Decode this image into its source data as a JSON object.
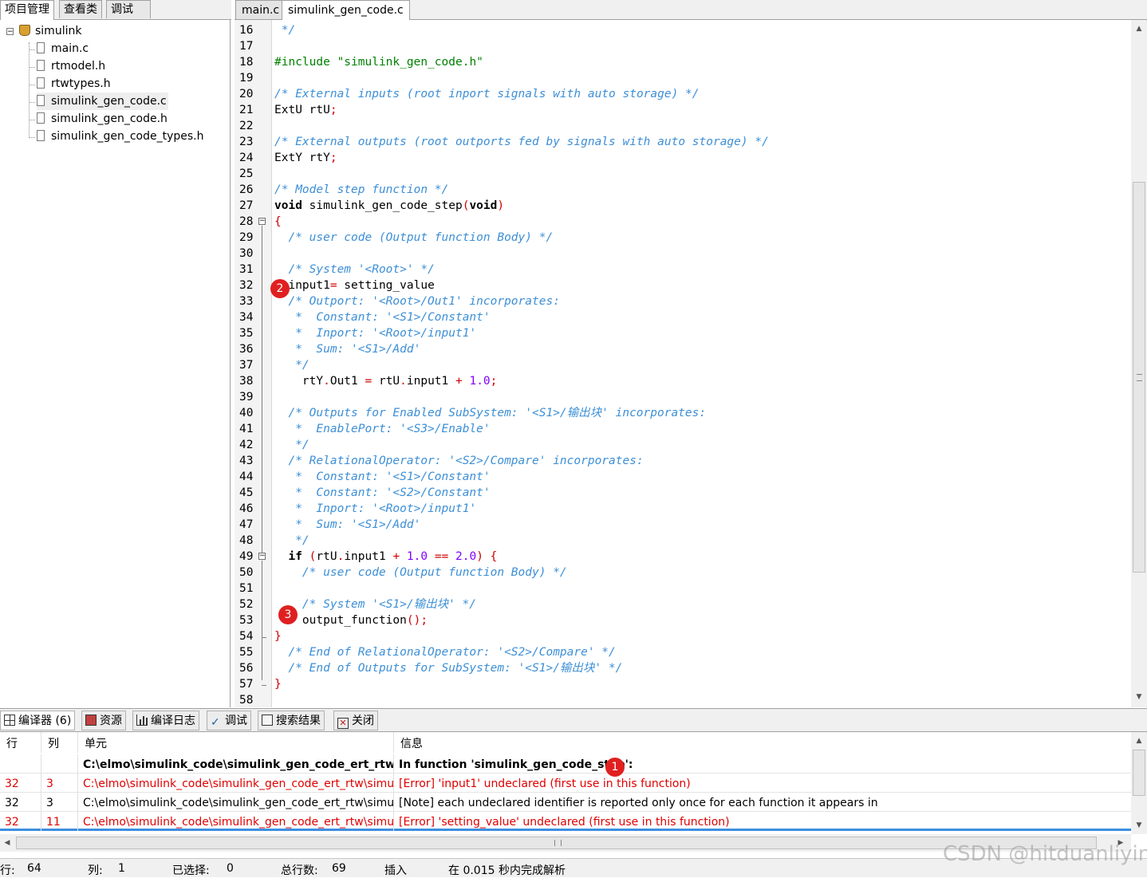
{
  "left_panel": {
    "tabs": [
      "项目管理",
      "查看类",
      "调试"
    ],
    "project": "simulink",
    "files": [
      "main.c",
      "rtmodel.h",
      "rtwtypes.h",
      "simulink_gen_code.c",
      "simulink_gen_code.h",
      "simulink_gen_code_types.h"
    ]
  },
  "editor": {
    "tabs": [
      "main.c",
      "simulink_gen_code.c"
    ],
    "line_numbers": [
      "16",
      "17",
      "18",
      "19",
      "20",
      "21",
      "22",
      "23",
      "24",
      "25",
      "26",
      "27",
      "28",
      "29",
      "30",
      "31",
      "32",
      "33",
      "34",
      "35",
      "36",
      "37",
      "38",
      "39",
      "40",
      "41",
      "42",
      "43",
      "44",
      "45",
      "46",
      "47",
      "48",
      "49",
      "50",
      "51",
      "52",
      "53",
      "54",
      "55",
      "56",
      "57",
      "58"
    ],
    "code": {
      "l16": " */",
      "l18_a": "#include ",
      "l18_b": "\"simulink_gen_code.h\"",
      "l20": "/* External inputs (root inport signals with auto storage) */",
      "l21_a": "ExtU rtU",
      "l21_b": ";",
      "l23": "/* External outputs (root outports fed by signals with auto storage) */",
      "l24_a": "ExtY rtY",
      "l24_b": ";",
      "l26": "/* Model step function */",
      "l27_a": "void",
      "l27_b": " simulink_gen_code_step",
      "l27_c": "(",
      "l27_d": "void",
      "l27_e": ")",
      "l28": "{",
      "l29": "  /* user code (Output function Body) */",
      "l31": "  /* System '<Root>' */",
      "l32_a": "  input1",
      "l32_b": "=",
      "l32_c": " setting_value",
      "l33": "  /* Outport: '<Root>/Out1' incorporates:",
      "l34": "   *  Constant: '<S1>/Constant'",
      "l35": "   *  Inport: '<Root>/input1'",
      "l36": "   *  Sum: '<S1>/Add'",
      "l37": "   */",
      "l38_a": "    rtY",
      "l38_b": ".",
      "l38_c": "Out1 ",
      "l38_d": "=",
      "l38_e": " rtU",
      "l38_f": ".",
      "l38_g": "input1 ",
      "l38_h": "+",
      "l38_i": " 1.0",
      "l38_j": ";",
      "l40": "  /* Outputs for Enabled SubSystem: '<S1>/输出块' incorporates:",
      "l41": "   *  EnablePort: '<S3>/Enable'",
      "l42": "   */",
      "l43": "  /* RelationalOperator: '<S2>/Compare' incorporates:",
      "l44": "   *  Constant: '<S1>/Constant'",
      "l45": "   *  Constant: '<S2>/Constant'",
      "l46": "   *  Inport: '<Root>/input1'",
      "l47": "   *  Sum: '<S1>/Add'",
      "l48": "   */",
      "l49_a": "  if",
      "l49_b": " (",
      "l49_c": "rtU",
      "l49_d": ".",
      "l49_e": "input1 ",
      "l49_f": "+",
      "l49_g": " 1.0 ",
      "l49_h": "==",
      "l49_i": " 2.0",
      "l49_j": ") {",
      "l50": "    /* user code (Output function Body) */",
      "l52": "    /* System '<S1>/输出块' */",
      "l53_a": "    output_function",
      "l53_b": "();",
      "l54": "}",
      "l55": "  /* End of RelationalOperator: '<S2>/Compare' */",
      "l56": "  /* End of Outputs for SubSystem: '<S1>/输出块' */",
      "l57": "}"
    },
    "badges": [
      "2",
      "3"
    ]
  },
  "bottom_tabs": [
    "编译器 (6)",
    "资源",
    "编译日志",
    "调试",
    "搜索结果",
    "关闭"
  ],
  "messages": {
    "headers": [
      "行",
      "列",
      "单元",
      "信息"
    ],
    "badge": "1",
    "rows": [
      {
        "line": "",
        "col": "",
        "unit": "C:\\elmo\\simulink_code\\simulink_gen_code_ert_rtw\\s...",
        "info": "In function 'simulink_gen_code_step':",
        "type": "header"
      },
      {
        "line": "32",
        "col": "3",
        "unit": "C:\\elmo\\simulink_code\\simulink_gen_code_ert_rtw\\simul...",
        "info": "[Error] 'input1' undeclared (first use in this function)",
        "type": "error"
      },
      {
        "line": "32",
        "col": "3",
        "unit": "C:\\elmo\\simulink_code\\simulink_gen_code_ert_rtw\\simul...",
        "info": "[Note] each undeclared identifier is reported only once for each function it appears in",
        "type": "note"
      },
      {
        "line": "32",
        "col": "11",
        "unit": "C:\\elmo\\simulink_code\\simulink_gen_code_ert_rtw\\simul...",
        "info": "[Error] 'setting_value' undeclared (first use in this function)",
        "type": "error"
      }
    ]
  },
  "status": {
    "row_label": "行:",
    "row_value": "64",
    "col_label": "列:",
    "col_value": "1",
    "sel_label": "已选择:",
    "sel_value": "0",
    "total_label": "总行数:",
    "total_value": "69",
    "mode": "插入",
    "parse_msg": "在 0.015 秒内完成解析"
  },
  "watermark": "CSDN @hitduanliying"
}
